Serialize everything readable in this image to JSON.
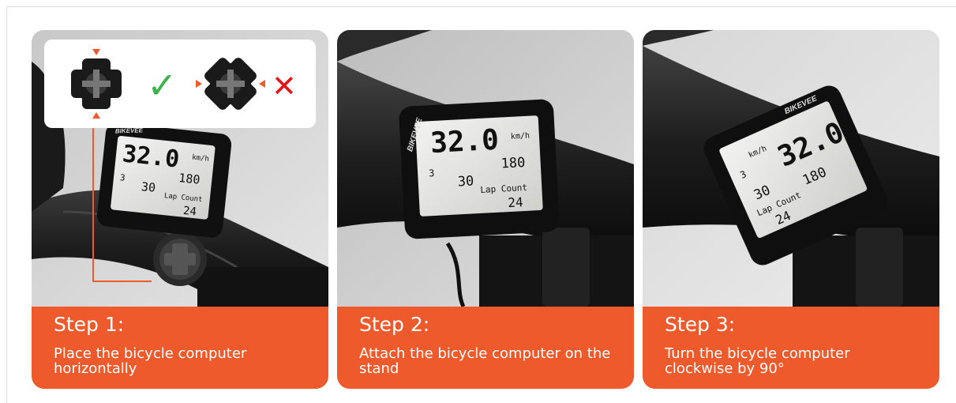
{
  "steps": [
    {
      "title": "Step 1:",
      "description": "Place the bicycle computer horizontally",
      "device_brand": "BIKEVEE",
      "screen": {
        "speed": "32.0",
        "speed_unit": "km/h",
        "value_right": "180",
        "value_left": "30",
        "lap_label": "Lap Count",
        "lap_value": "24",
        "digit_small": "3"
      }
    },
    {
      "title": "Step 2:",
      "description": "Attach the bicycle computer on the stand",
      "device_brand": "BIKEVEE",
      "screen": {
        "speed": "32.0",
        "speed_unit": "km/h",
        "value_right": "180",
        "value_left": "30",
        "lap_label": "Lap Count",
        "lap_value": "24",
        "digit_small": "3"
      }
    },
    {
      "title": "Step 3:",
      "description": "Turn the bicycle computer clockwise by 90°",
      "device_brand": "BIKEVEE",
      "screen": {
        "speed": "32.0",
        "speed_unit": "km/h",
        "value_right": "180",
        "value_left": "30",
        "lap_label": "Lap Count",
        "lap_value": "24",
        "digit_small": "3"
      }
    }
  ],
  "mount_guide": {
    "correct_symbol": "✓",
    "wrong_symbol": "✕",
    "correct_color": "#3bb54a",
    "wrong_color": "#e4161b",
    "arrow_color": "#ee5a2b"
  },
  "colors": {
    "accent": "#ee5a2b",
    "caption_text": "#ffffff"
  }
}
